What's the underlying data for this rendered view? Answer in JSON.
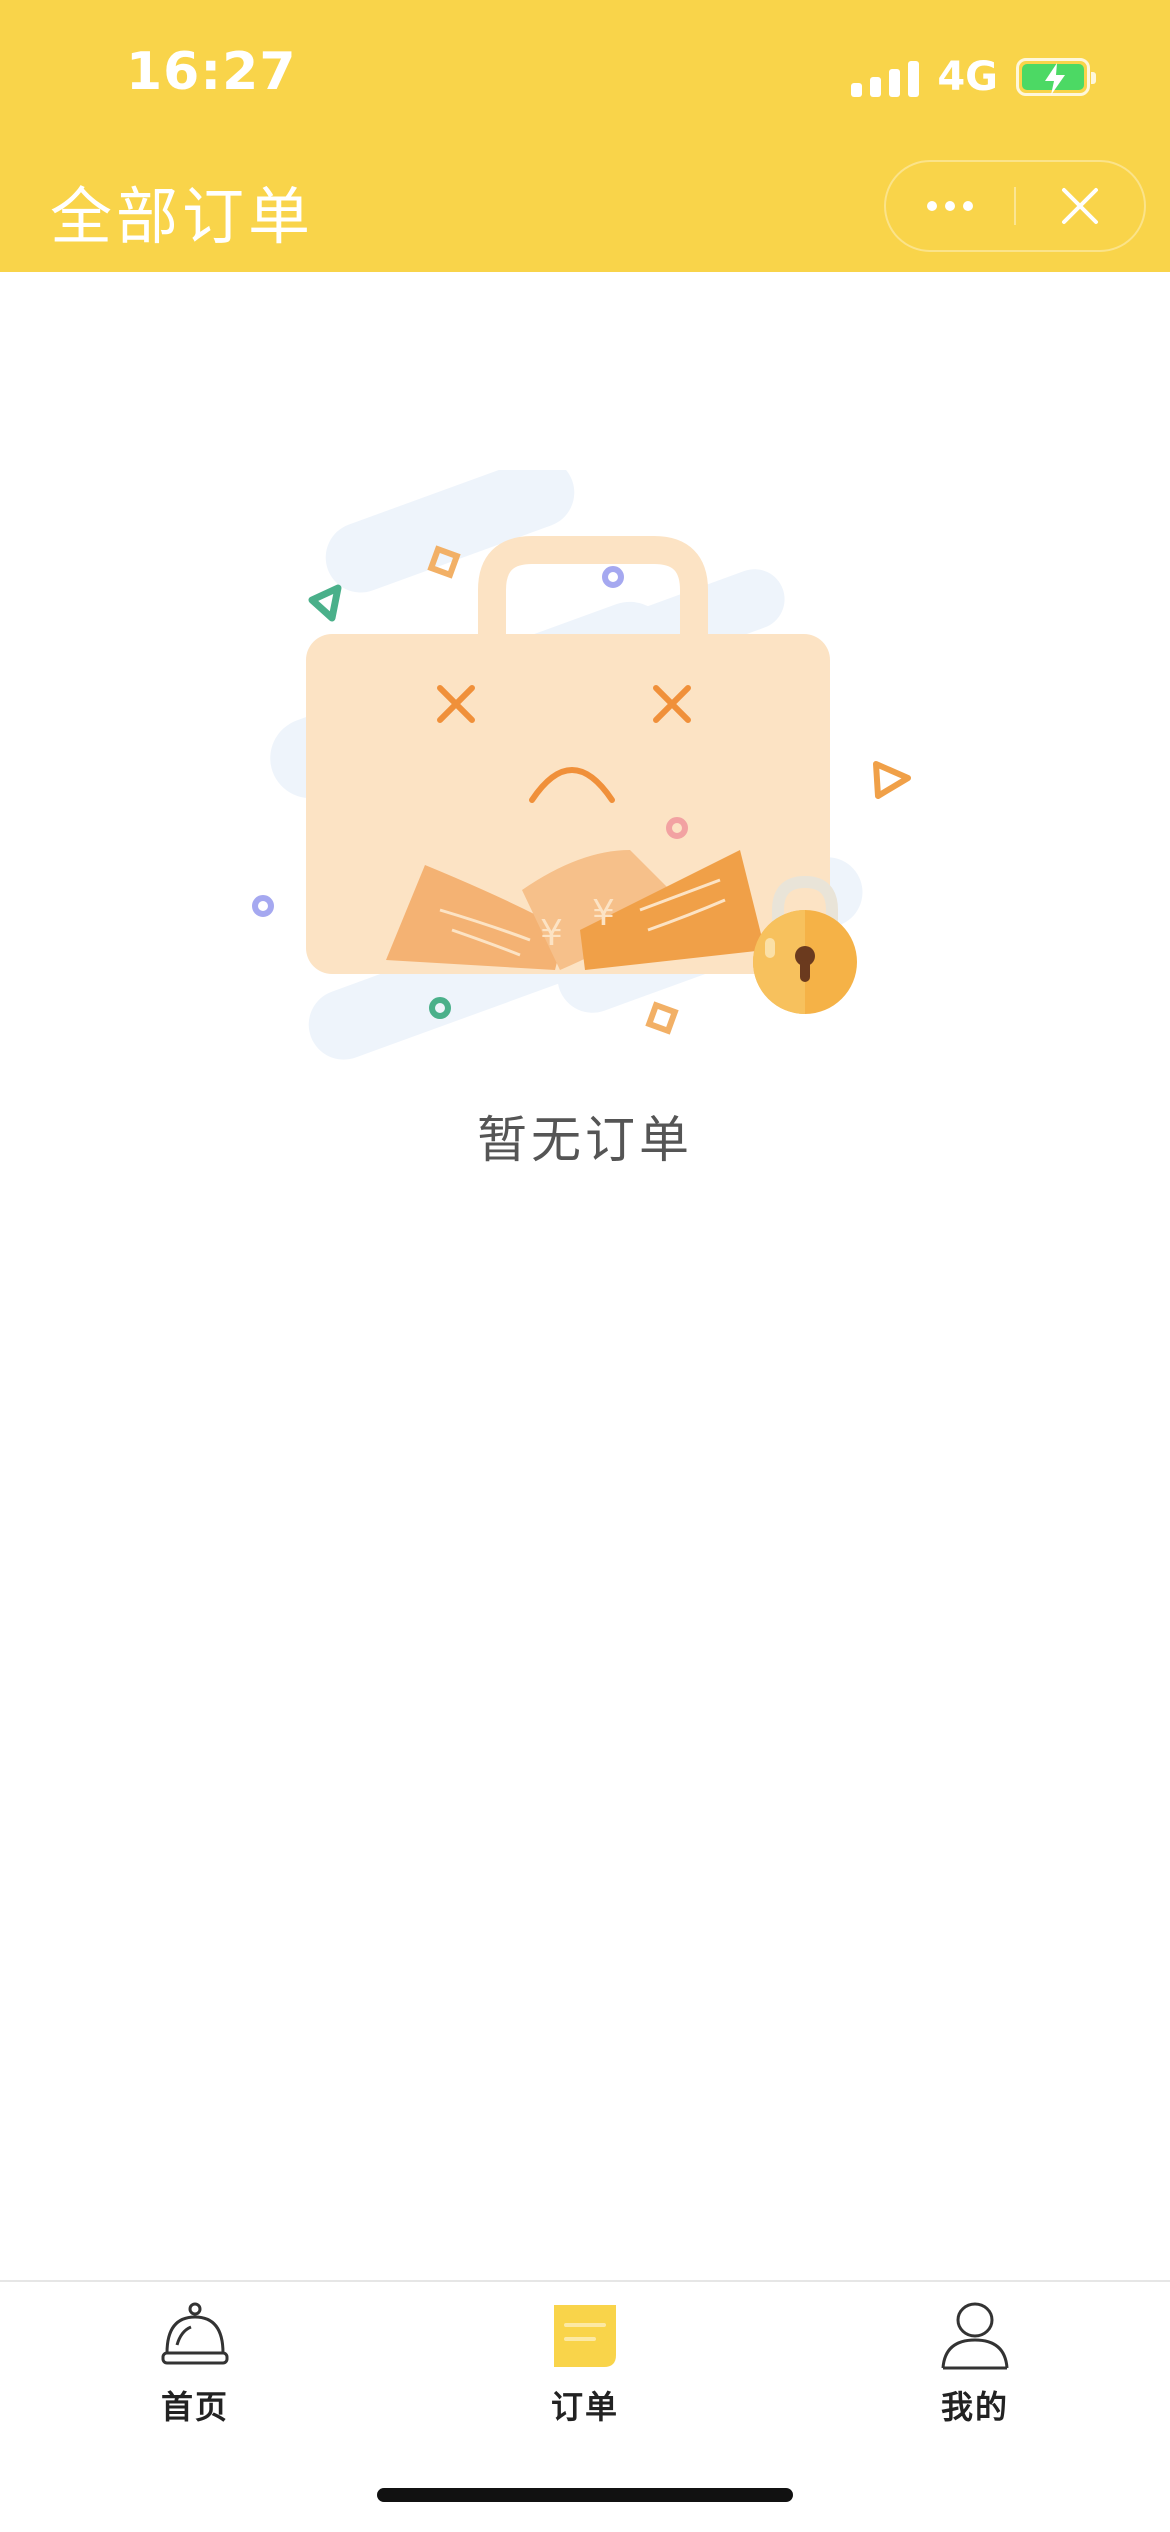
{
  "status_bar": {
    "time": "16:27",
    "network": "4G",
    "battery_level": 1.0,
    "charging": true,
    "signal_icon": "signal-bars-icon"
  },
  "nav": {
    "title": "全部订单",
    "more_icon": "more-dots-icon",
    "close_icon": "close-icon"
  },
  "empty_state": {
    "illustration": "empty-shopping-bag-illustration",
    "text": "暂无订单"
  },
  "tabbar": {
    "active_index": 1,
    "active_color": "#F9D44A",
    "items": [
      {
        "label": "首页",
        "icon": "service-bell-icon"
      },
      {
        "label": "订单",
        "icon": "order-note-icon"
      },
      {
        "label": "我的",
        "icon": "person-icon"
      }
    ]
  },
  "colors": {
    "header_bg": "#F9D44A",
    "bag_fill": "#FCE3C4",
    "accent_orange": "#F0A048"
  }
}
